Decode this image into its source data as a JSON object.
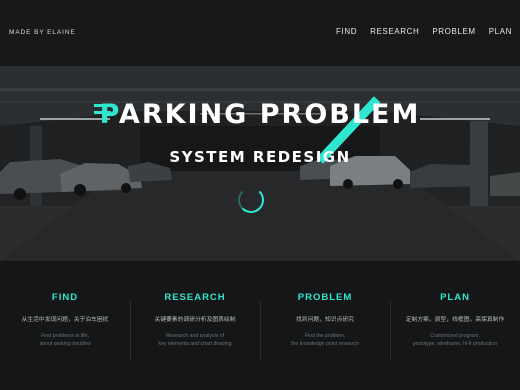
{
  "header": {
    "brand": "MADE BY ELAINE",
    "nav": [
      "FIND",
      "RESEARCH",
      "PROBLEM",
      "PLAN"
    ]
  },
  "hero": {
    "title_first": "P",
    "title_rest": "ARKING PROBLEM",
    "subtitle": "SYSTEM REDESIGN"
  },
  "features": [
    {
      "title": "FIND",
      "cn": "从生活中发现问题，关于泊车困扰",
      "desc1": "Find problems in life,",
      "desc2": "about parking troubles"
    },
    {
      "title": "RESEARCH",
      "cn": "关键要素的调研分析及图表绘制",
      "desc1": "Research and analysis of",
      "desc2": "key elements and chart drawing"
    },
    {
      "title": "PROBLEM",
      "cn": "找到问题，知识点研究",
      "desc1": "Find the problem,",
      "desc2": "the knowledge point research"
    },
    {
      "title": "PLAN",
      "cn": "定制方案，原型，线框图，高保真制作",
      "desc1": "Customized program,",
      "desc2": "prototype, wireframe, hi-fi production"
    }
  ],
  "colors": {
    "accent": "#2fe6d0",
    "background": "#141617"
  }
}
